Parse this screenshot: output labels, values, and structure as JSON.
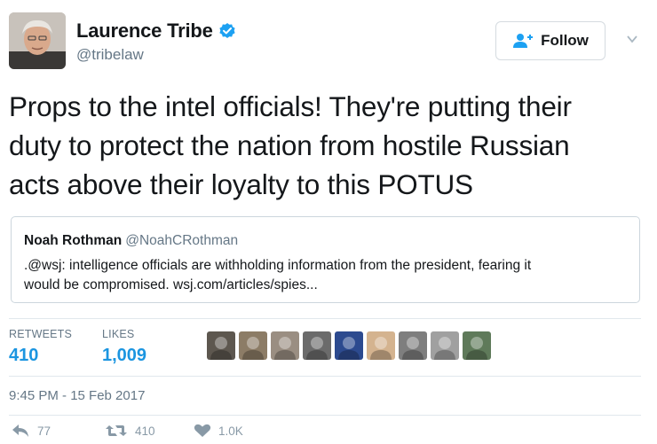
{
  "user": {
    "display_name": "Laurence Tribe",
    "handle": "@tribelaw",
    "verified": true
  },
  "follow_button": {
    "label": "Follow",
    "icon": "add-user-icon"
  },
  "menu": {
    "icon": "chevron-down-icon"
  },
  "tweet": {
    "lines": [
      "Props to the intel officials! They're putting their",
      "duty to protect the nation from hostile Russian",
      "acts above their loyalty to this POTUS"
    ]
  },
  "quote": {
    "name": "Noah Rothman",
    "handle": "@NoahCRothman",
    "lines": [
      ".@wsj: intelligence officials are withholding information from the president, fearing it",
      "would be compromised. wsj.com/articles/spies..."
    ]
  },
  "stats": {
    "retweets_label": "RETWEETS",
    "retweets_value": "410",
    "likes_label": "LIKES",
    "likes_value": "1,009"
  },
  "likers": [
    {
      "name": "liker-1",
      "color": "#5d574f"
    },
    {
      "name": "liker-2",
      "color": "#8c7c66"
    },
    {
      "name": "liker-3",
      "color": "#9a8e82"
    },
    {
      "name": "liker-4",
      "color": "#6b6b6b"
    },
    {
      "name": "liker-5",
      "color": "#2c4a8f"
    },
    {
      "name": "liker-6",
      "color": "#d4b38f"
    },
    {
      "name": "liker-7",
      "color": "#7e7e7e"
    },
    {
      "name": "liker-8",
      "color": "#a0a0a0"
    },
    {
      "name": "liker-9",
      "color": "#5f7a5a"
    }
  ],
  "timestamp": "9:45 PM - 15 Feb 2017",
  "actions": {
    "reply_count": "77",
    "retweet_count": "410",
    "like_count": "1.0K"
  },
  "colors": {
    "accent": "#1b95e0",
    "secondary_text": "#657786",
    "border": "#ccd6dd"
  }
}
